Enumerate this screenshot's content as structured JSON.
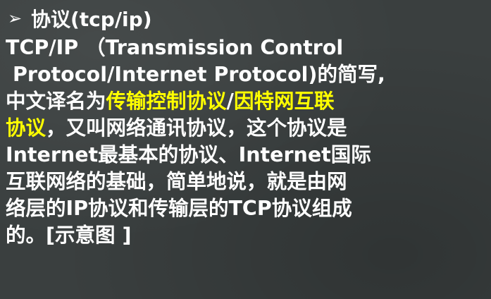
{
  "heading": {
    "bullet": "➢",
    "text": "协议(tcp/ip)"
  },
  "body": {
    "l1": "TCP/IP （Transmission Control",
    "l2": "Protocol/Internet Protocol)的简写,",
    "l3_a": "中文译名为",
    "l3_hl1": "传输控制协议",
    "l3_sep": "/",
    "l3_hl2": "因特网互联",
    "l4_hl": "协议",
    "l4_rest": "，又叫网络通讯协议，这个协议是",
    "l5": "Internet最基本的协议、Internet国际",
    "l6": "互联网络的基础，简单地说，就是由网",
    "l7": "络层的IP协议和传输层的TCP协议组成",
    "l8": "的。[示意图 ]"
  },
  "colors": {
    "background": "#3a3f3f",
    "text": "#ffffff",
    "highlight": "#ffff00"
  }
}
